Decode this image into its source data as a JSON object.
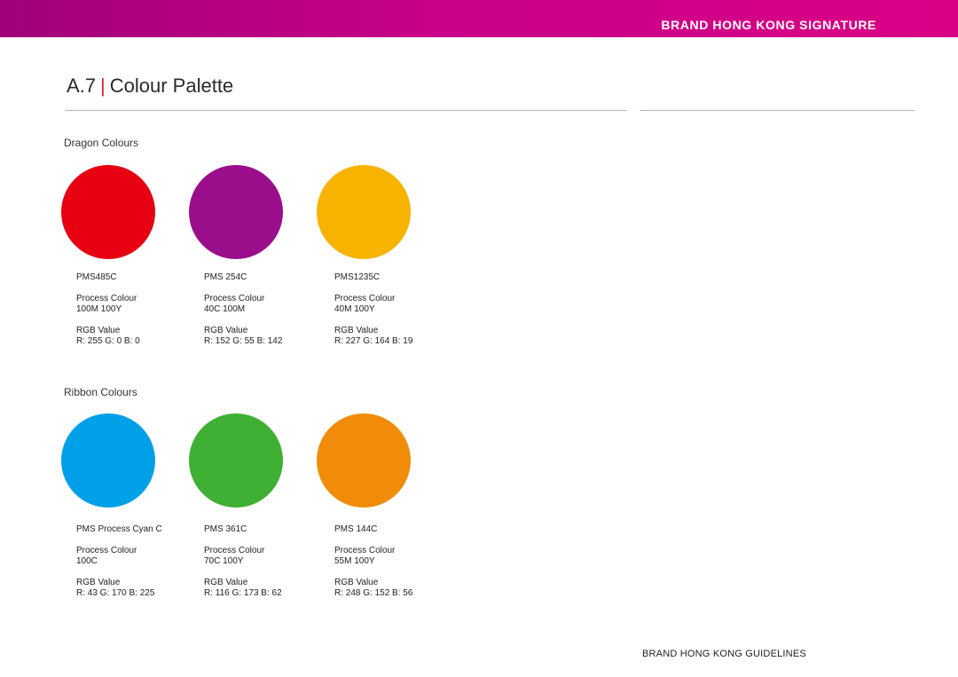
{
  "header": {
    "brand": "BRAND HONG KONG SIGNATURE"
  },
  "title": {
    "number": "A.7",
    "separator": "|",
    "text": "Colour Palette"
  },
  "dragon": {
    "title": "Dragon Colours",
    "colours": [
      {
        "pms": "PMS485C",
        "process_label": "Process Colour",
        "process": "100M 100Y",
        "rgb_label": "RGB Value",
        "rgb": "R: 255 G: 0 B: 0",
        "hex": "#e60012"
      },
      {
        "pms": "PMS 254C",
        "process_label": "Process Colour",
        "process": "40C 100M",
        "rgb_label": "RGB Value",
        "rgb": "R: 152   G: 55 B: 142",
        "hex": "#9b0e8b"
      },
      {
        "pms": "PMS1235C",
        "process_label": "Process Colour",
        "process": "40M 100Y",
        "rgb_label": "RGB Value",
        "rgb": "R: 227 G: 164 B: 19",
        "hex": "#f8b200"
      }
    ]
  },
  "ribbon": {
    "title": "Ribbon Colours",
    "colours": [
      {
        "pms": "PMS Process Cyan C",
        "process_label": "Process Colour",
        "process": "100C",
        "rgb_label": "RGB Value",
        "rgb": "R: 43  G: 170  B: 225",
        "hex": "#00a0e9"
      },
      {
        "pms": "PMS 361C",
        "process_label": "Process Colour",
        "process": "70C 100Y",
        "rgb_label": "RGB Value",
        "rgb": "R: 116  G: 173  B: 62",
        "hex": "#3fb034"
      },
      {
        "pms": "PMS 144C",
        "process_label": "Process Colour",
        "process": "55M 100Y",
        "rgb_label": "RGB Value",
        "rgb": "R: 248  G: 152  B: 56",
        "hex": "#f08c0a"
      }
    ]
  },
  "footer": {
    "text": "BRAND HONG KONG GUIDELINES"
  }
}
